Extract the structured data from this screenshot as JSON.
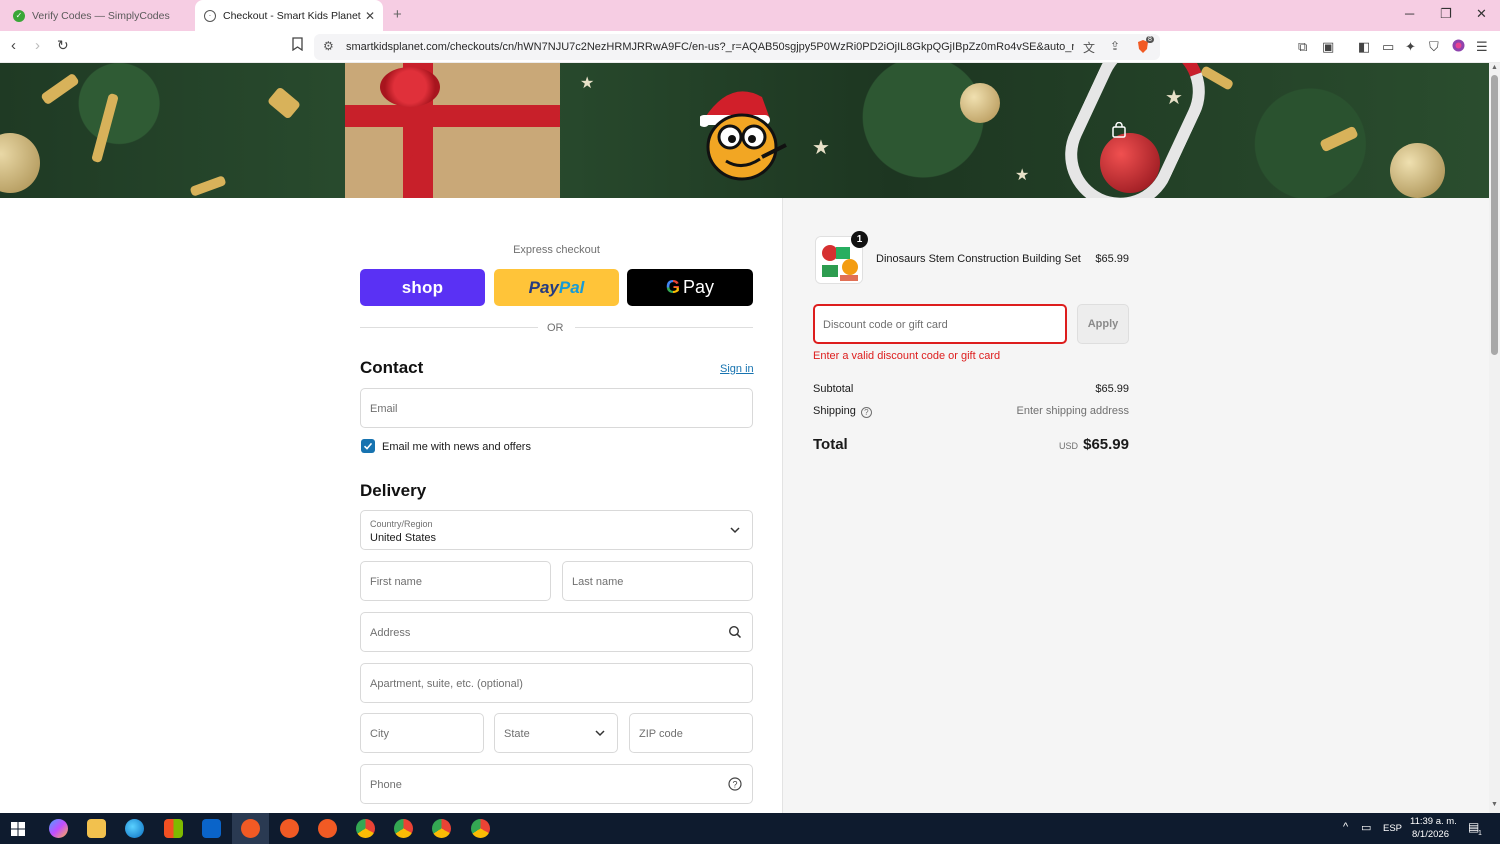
{
  "browser": {
    "tabs": [
      {
        "title": "Verify Codes — SimplyCodes"
      },
      {
        "title": "Checkout - Smart Kids Planet"
      }
    ],
    "url": "smartkidsplanet.com/checkouts/cn/hWN7NJU7c2NezHRMJRRwA9FC/en-us?_r=AQAB50sgjpy5P0WzRi0PD2iOjIL8GkpQGjIBpZz0mRo4vSE&auto_redir...",
    "brave_badge": "8"
  },
  "express": {
    "label": "Express checkout",
    "shop": "shop",
    "paypal_a": "Pay",
    "paypal_b": "Pal",
    "gpay_g": "G",
    "gpay": "Pay",
    "or": "OR"
  },
  "contact": {
    "title": "Contact",
    "signin": "Sign in",
    "email_placeholder": "Email",
    "newsletter_label": "Email me with news and offers",
    "newsletter_checked": true
  },
  "delivery": {
    "title": "Delivery",
    "country_label": "Country/Region",
    "country_value": "United States",
    "first_name": "First name",
    "last_name": "Last name",
    "address": "Address",
    "apartment": "Apartment, suite, etc. (optional)",
    "city": "City",
    "state": "State",
    "zip": "ZIP code",
    "phone": "Phone"
  },
  "summary": {
    "product": {
      "name": "Dinosaurs Stem Construction Building Set",
      "price": "$65.99",
      "quantity": "1"
    },
    "discount_placeholder": "Discount code or gift card",
    "apply": "Apply",
    "error": "Enter a valid discount code or gift card",
    "subtotal_label": "Subtotal",
    "subtotal_value": "$65.99",
    "shipping_label": "Shipping",
    "shipping_value": "Enter shipping address",
    "total_label": "Total",
    "currency": "USD",
    "total_value": "$65.99"
  },
  "taskbar": {
    "lang": "ESP",
    "time": "11:39 a. m.",
    "date": "8/1/2026",
    "notif_count": "1"
  },
  "colors": {
    "shop_pay": "#5a31f4",
    "paypal": "#ffc439",
    "link": "#1773b0",
    "error": "#dd1d1d"
  }
}
